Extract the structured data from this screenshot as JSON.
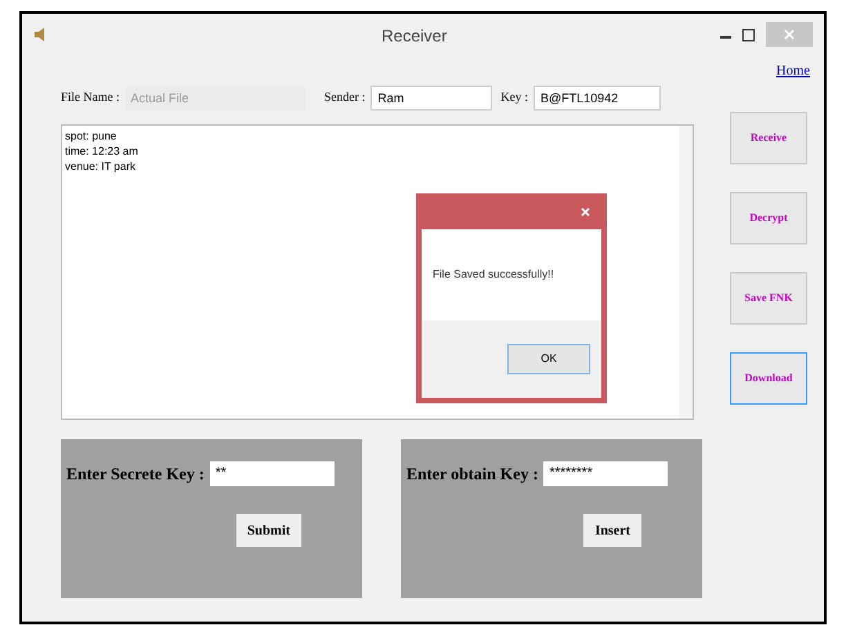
{
  "window": {
    "title": "Receiver"
  },
  "home_link": "Home",
  "file_name": {
    "label": "File Name :",
    "placeholder": "Actual File"
  },
  "sender": {
    "label": "Sender :",
    "value": "Ram"
  },
  "key": {
    "label": "Key :",
    "value": "B@FTL10942"
  },
  "message_text": [
    "spot: pune",
    "time: 12:23 am",
    "venue: IT park"
  ],
  "side_buttons": [
    {
      "label": "Receive",
      "focused": false
    },
    {
      "label": "Decrypt",
      "focused": false
    },
    {
      "label": "Save FNK",
      "focused": false
    },
    {
      "label": "Download",
      "focused": true
    }
  ],
  "secret_panel": {
    "label": "Enter Secrete Key :",
    "value": "**",
    "button": "Submit"
  },
  "obtain_panel": {
    "label": "Enter obtain Key :",
    "value": "********",
    "button": "Insert"
  },
  "dialog": {
    "message": "File Saved successfully!!",
    "button": "OK"
  }
}
